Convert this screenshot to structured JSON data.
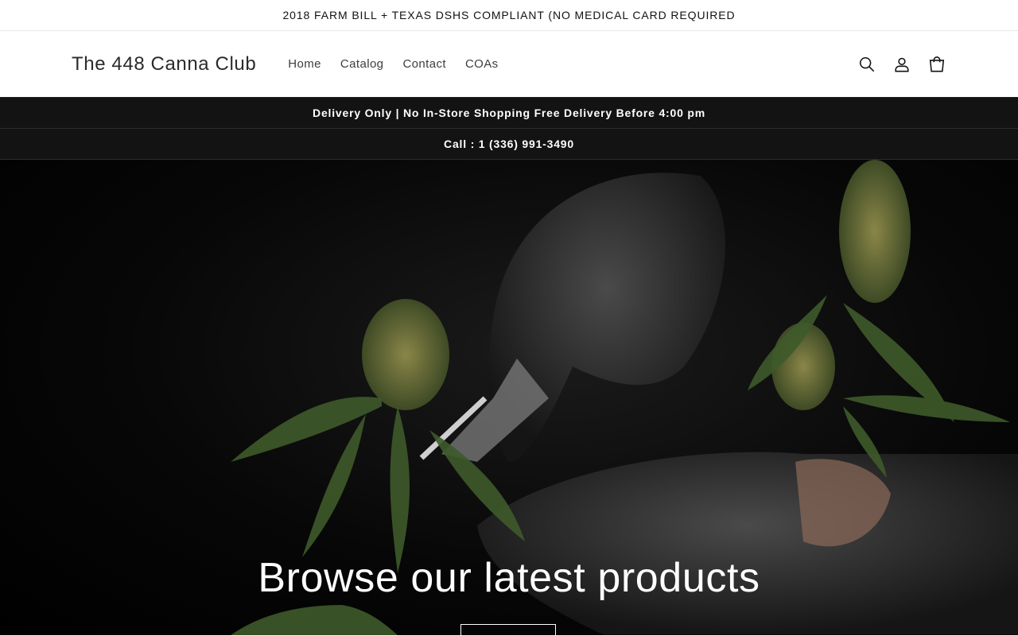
{
  "announcement": {
    "text": "2018 FARM BILL + TEXAS DSHS COMPLIANT (NO MEDICAL CARD REQUIRED"
  },
  "header": {
    "logo": "The 448 Canna Club",
    "nav": [
      {
        "label": "Home"
      },
      {
        "label": "Catalog"
      },
      {
        "label": "Contact"
      },
      {
        "label": "COAs"
      }
    ],
    "icons": [
      "search-icon",
      "account-icon",
      "cart-icon"
    ]
  },
  "info_bars": {
    "delivery": "Delivery Only | No In-Store Shopping Free Delivery Before 4:00 pm",
    "phone": "Call : 1 (336) 991-3490"
  },
  "hero": {
    "title": "Browse our latest products",
    "button_label": ""
  },
  "colors": {
    "bar_bg": "#131313",
    "hero_bg": "#000000",
    "text": "#121212"
  }
}
